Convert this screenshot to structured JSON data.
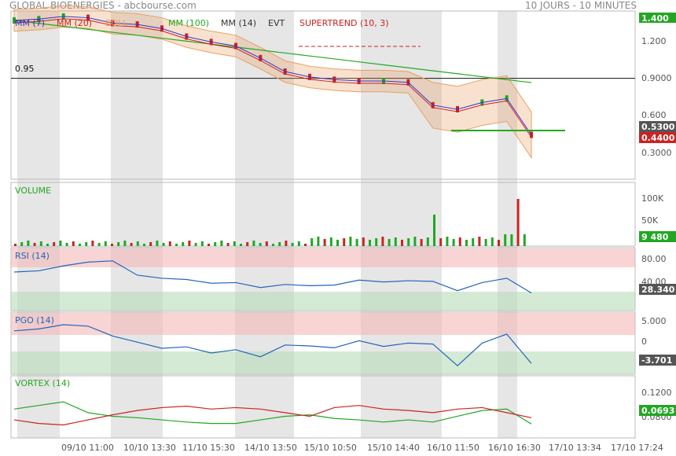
{
  "header": {
    "title": "GLOBAL BIOENERGIES - abcbourse.com",
    "period": "10 JOURS - 10 MINUTES"
  },
  "colors": {
    "up": "#22a722",
    "down": "#cc2222",
    "mm7": "#3333cc",
    "mm20": "#cc2222",
    "mm100": "#22aa22",
    "boll": "#e8a060",
    "rsi": "#2266bb",
    "vortex_plus": "#22a722",
    "vortex_minus": "#cc2222",
    "shade": "#e6e6e6"
  },
  "price_panel": {
    "legend": {
      "mm7": "MM (7)",
      "mm20": "MM (20)",
      "boll": "BOLL",
      "mm100": "MM (100)",
      "mm14": "MM (14)",
      "evt": "EVT",
      "supertrend": "SUPERTREND (10, 3)"
    },
    "hline_label": "0.95",
    "y_ticks": [
      "1.400",
      "1.200",
      "0.9000",
      "0.600",
      "0.3000"
    ],
    "last_badge": "0.5300",
    "low_badge": "0.4400"
  },
  "volume_panel": {
    "label": "VOLUME",
    "y_ticks": [
      "100K",
      "50K"
    ],
    "last_badge": "9 480"
  },
  "rsi_panel": {
    "label": "RSI (14)",
    "y_ticks": [
      "80.00",
      "40.00"
    ],
    "last_badge": "28.340"
  },
  "pgo_panel": {
    "label": "PGO (14)",
    "y_ticks": [
      "5.000",
      "0"
    ],
    "last_badge": "-3.701"
  },
  "vortex_panel": {
    "label": "VORTEX (14)",
    "y_ticks": [
      "0.1200",
      "0.0800"
    ],
    "last_badge": "0.0693"
  },
  "x_labels": [
    "09/10 11:00",
    "10/10 13:30",
    "11/10 15:30",
    "14/10 13:50",
    "15/10 10:50",
    "15/10 14:40",
    "16/10 11:50",
    "16/10 16:30",
    "17/10 13:34",
    "17/10 17:24"
  ],
  "chart_data": {
    "type": "line",
    "x_labels": [
      "09/10 11:00",
      "10/10 13:30",
      "11/10 15:30",
      "14/10 13:50",
      "15/10 10:50",
      "15/10 14:40",
      "16/10 11:50",
      "16/10 16:30",
      "17/10 13:34",
      "17/10 17:24"
    ],
    "price": {
      "y_range": [
        0.2,
        1.45
      ],
      "close": [
        1.38,
        1.39,
        1.41,
        1.4,
        1.36,
        1.35,
        1.32,
        1.26,
        1.22,
        1.19,
        1.1,
        1.0,
        0.96,
        0.94,
        0.93,
        0.93,
        0.92,
        0.75,
        0.72,
        0.77,
        0.8,
        0.53
      ],
      "last": 0.53,
      "low": 0.44
    },
    "volume": {
      "y_range": [
        0,
        120000
      ],
      "last": 9480,
      "max": 92000
    },
    "rsi": {
      "y_range": [
        0,
        100
      ],
      "overbought": 70,
      "oversold": 30,
      "values": [
        62,
        64,
        72,
        78,
        80,
        57,
        52,
        50,
        44,
        45,
        37,
        42,
        40,
        41,
        49,
        46,
        48,
        47,
        32,
        45,
        52,
        28.34
      ]
    },
    "pgo": {
      "y_range": [
        -6,
        7
      ],
      "values": [
        3.2,
        3.6,
        4.5,
        4.2,
        2.1,
        0.8,
        -0.5,
        -0.2,
        -1.5,
        -0.8,
        -2.3,
        0.2,
        0.0,
        -0.4,
        1.1,
        -0.1,
        0.6,
        0.4,
        -4.2,
        0.6,
        2.5,
        -3.701
      ]
    },
    "vortex": {
      "plus": [
        0.09,
        0.095,
        0.1,
        0.085,
        0.08,
        0.078,
        0.075,
        0.072,
        0.07,
        0.07,
        0.075,
        0.08,
        0.082,
        0.077,
        0.075,
        0.072,
        0.075,
        0.072,
        0.08,
        0.088,
        0.09,
        0.0693
      ],
      "minus": [
        0.075,
        0.07,
        0.068,
        0.075,
        0.082,
        0.088,
        0.092,
        0.094,
        0.09,
        0.092,
        0.09,
        0.085,
        0.08,
        0.092,
        0.095,
        0.09,
        0.088,
        0.085,
        0.09,
        0.092,
        0.085,
        0.078
      ],
      "y_range": [
        0.05,
        0.135
      ]
    }
  }
}
